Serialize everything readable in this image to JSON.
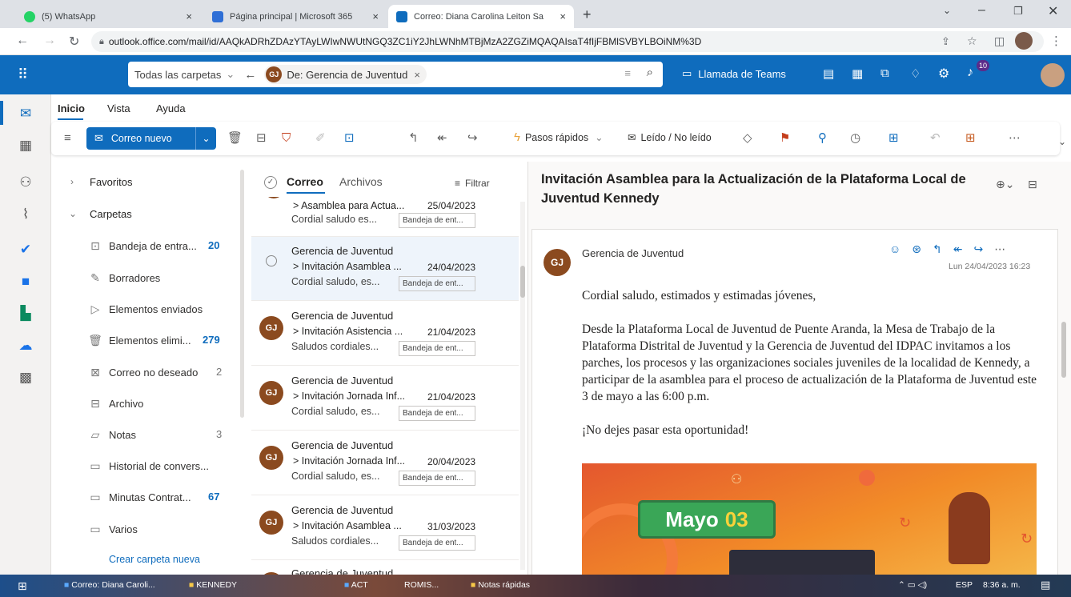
{
  "browser": {
    "tabs": [
      {
        "title": "(5) WhatsApp",
        "color": "#25d366"
      },
      {
        "title": "Página principal | Microsoft 365",
        "color": "#2f6fd6"
      },
      {
        "title": "Correo: Diana Carolina Leiton Sa",
        "color": "#0f6cbd"
      }
    ],
    "url": "outlook.office.com/mail/id/AAQkADRhZDAzYTAyLWIwNWUtNGQ3ZC1iY2JhLWNhMTBjMzA2ZGZiMQAQAIsaT4fIjFBMlSVBYLBOiNM%3D"
  },
  "suite": {
    "search_scope": "Todas las carpetas",
    "search_chip": "De: Gerencia de Juventud",
    "chip_initials": "GJ",
    "teams_call": "Llamada de Teams",
    "notif_count": "10"
  },
  "ribbon_tabs": [
    "Inicio",
    "Vista",
    "Ayuda"
  ],
  "ribbon": {
    "new_mail": "Correo nuevo",
    "quick_steps": "Pasos rápidos",
    "read_unread": "Leído / No leído"
  },
  "folders": {
    "favorites": "Favoritos",
    "folders": "Carpetas",
    "items": [
      {
        "name": "Bandeja de entra...",
        "count": "20",
        "icon": "inbox-icon"
      },
      {
        "name": "Borradores",
        "count": "",
        "icon": "pencil-icon"
      },
      {
        "name": "Elementos enviados",
        "count": "",
        "icon": "send-icon"
      },
      {
        "name": "Elementos elimi...",
        "count": "279",
        "icon": "trash-icon"
      },
      {
        "name": "Correo no deseado",
        "count": "2",
        "icon": "junk-icon"
      },
      {
        "name": "Archivo",
        "count": "",
        "icon": "archive-icon"
      },
      {
        "name": "Notas",
        "count": "3",
        "icon": "notes-icon"
      },
      {
        "name": "Historial de convers...",
        "count": "",
        "icon": "folder-icon"
      },
      {
        "name": "Minutas Contrat...",
        "count": "67",
        "icon": "folder-icon"
      },
      {
        "name": "Varios",
        "count": "",
        "icon": "folder-icon"
      }
    ],
    "create": "Crear carpeta nueva"
  },
  "list": {
    "tab_mail": "Correo",
    "tab_files": "Archivos",
    "filter": "Filtrar",
    "partial_top": {
      "subject": "> Asamblea para Actua...",
      "date": "25/04/2023",
      "preview": "Cordial saludo es...",
      "tag": "Bandeja de ent..."
    },
    "items": [
      {
        "sender": "Gerencia de Juventud",
        "subject": "> Invitación Asamblea ...",
        "date": "24/04/2023",
        "preview": "Cordial saludo, es...",
        "tag": "Bandeja de ent..."
      },
      {
        "sender": "Gerencia de Juventud",
        "subject": "> Invitación Asistencia ...",
        "date": "21/04/2023",
        "preview": "Saludos cordiales...",
        "tag": "Bandeja de ent..."
      },
      {
        "sender": "Gerencia de Juventud",
        "subject": "> Invitación Jornada Inf...",
        "date": "21/04/2023",
        "preview": "Cordial saludo, es...",
        "tag": "Bandeja de ent..."
      },
      {
        "sender": "Gerencia de Juventud",
        "subject": "> Invitación Jornada Inf...",
        "date": "20/04/2023",
        "preview": "Cordial saludo, es...",
        "tag": "Bandeja de ent..."
      },
      {
        "sender": "Gerencia de Juventud",
        "subject": "> Invitación Asamblea ...",
        "date": "31/03/2023",
        "preview": "Saludos cordiales...",
        "tag": "Bandeja de ent..."
      }
    ],
    "partial_bottom_sender": "Gerencia de Juventud",
    "initials": "GJ"
  },
  "reading": {
    "subject": "Invitación Asamblea para la Actualización de la Plataforma Local de Juventud Kennedy",
    "sender": "Gerencia de Juventud",
    "initials": "GJ",
    "datetime": "Lun 24/04/2023 16:23",
    "greeting": "Cordial saludo, estimados y estimadas jóvenes,",
    "body": "Desde la Plataforma Local de Juventud de Puente Aranda, la Mesa de Trabajo de la Plataforma Distrital de Juventud y la Gerencia de Juventud del IDPAC invitamos a los parches, los procesos y las organizaciones sociales juveniles de la localidad de Kennedy, a participar de la asamblea para el proceso de actualización de la Plataforma de Juventud este 3 de mayo a las 6:00 p.m.",
    "closing": "¡No dejes pasar esta oportunidad!",
    "banner_word": "Mayo",
    "banner_num": "03"
  },
  "taskbar": {
    "items": [
      "Correo: Diana Caroli...",
      "KENNEDY",
      "ACT",
      "ROMIS...",
      "Notas rápidas"
    ],
    "lang": "ESP",
    "time": "8:36 a. m."
  }
}
